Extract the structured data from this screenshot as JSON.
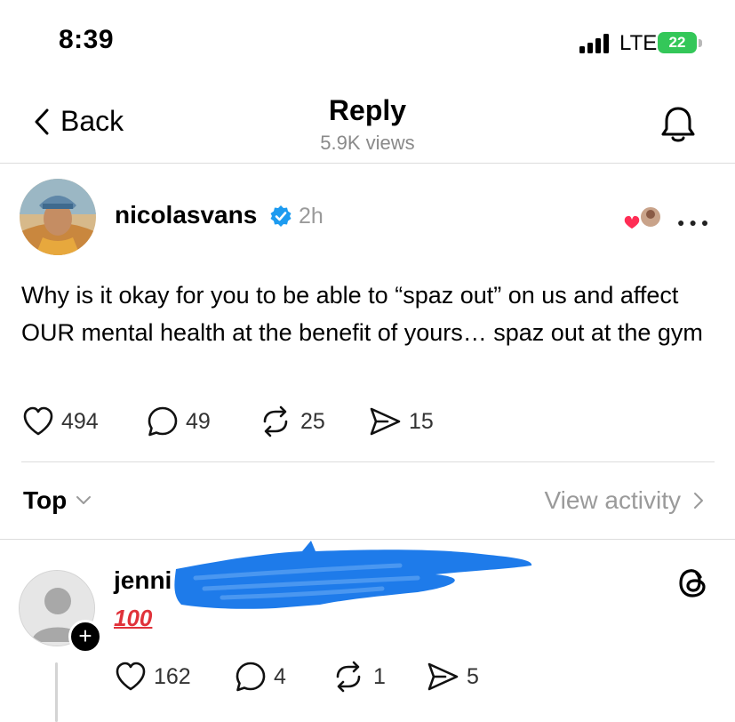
{
  "status_bar": {
    "time": "8:39",
    "network": "LTE",
    "battery": "22"
  },
  "nav": {
    "back_label": "Back",
    "title": "Reply",
    "views": "5.9K views"
  },
  "post": {
    "username": "nicolasvans",
    "time_ago": "2h",
    "text": "Why is it okay for you to be able to “spaz out” on us and affect OUR mental health at the benefit of yours… spaz out at the gym",
    "likes": "494",
    "replies": "49",
    "reposts": "25",
    "shares": "15"
  },
  "sort": {
    "label": "Top",
    "view_activity": "View activity"
  },
  "reply": {
    "username_visible": "jenni",
    "emoji_text": "100",
    "likes": "162",
    "replies": "4",
    "reposts": "1",
    "shares": "5"
  },
  "colors": {
    "accent_verified": "#1d9bf0",
    "battery_green": "#34c759",
    "scribble_blue": "#1e7bea",
    "muted_text": "#9a9a9a"
  }
}
